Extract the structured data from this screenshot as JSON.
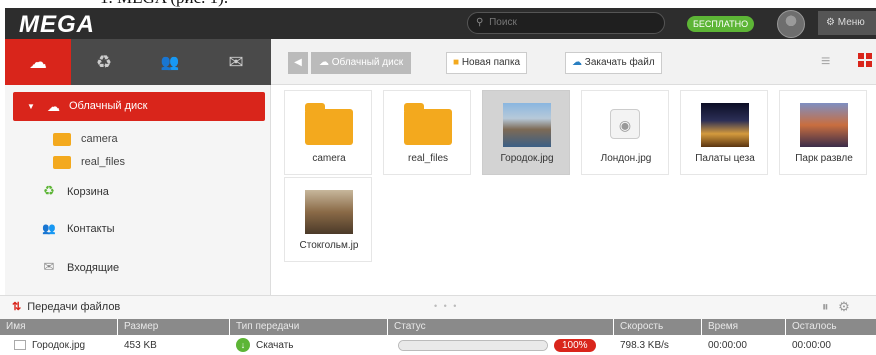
{
  "caption": "1. MEGA (рис. 1).",
  "header": {
    "logo": "MEGA",
    "search_placeholder": "Поиск",
    "plan_badge": "БЕСПЛАТНО",
    "menu_label": "Меню"
  },
  "tabs": [
    {
      "name": "cloud",
      "icon": "cloud-icon",
      "active": true
    },
    {
      "name": "rubbish",
      "icon": "recycle-icon",
      "active": false
    },
    {
      "name": "contacts",
      "icon": "contacts-icon",
      "active": false
    },
    {
      "name": "inbox",
      "icon": "envelope-icon",
      "active": false
    }
  ],
  "toolbar": {
    "breadcrumb": "Облачный диск",
    "new_folder": "Новая папка",
    "upload_file": "Закачать файл"
  },
  "sidebar": {
    "active_item": "Облачный диск",
    "folders": [
      "camera",
      "real_files"
    ],
    "items": [
      "Корзина",
      "Контакты",
      "Входящие"
    ]
  },
  "files": [
    {
      "name": "camera",
      "kind": "folder"
    },
    {
      "name": "real_files",
      "kind": "folder"
    },
    {
      "name": "Городок.jpg",
      "kind": "photo",
      "selected": true
    },
    {
      "name": "Лондон.jpg",
      "kind": "camera"
    },
    {
      "name": "Палаты цеза",
      "kind": "photo"
    },
    {
      "name": "Парк развле",
      "kind": "photo"
    },
    {
      "name": "Стокгольм.jp",
      "kind": "photo"
    }
  ],
  "transfers": {
    "title": "Передачи файлов",
    "columns": [
      "Имя",
      "Размер",
      "Тип передачи",
      "Статус",
      "Скорость",
      "Время",
      "Осталось"
    ],
    "rows": [
      {
        "name": "Городок.jpg",
        "size": "453 KB",
        "type": "Скачать",
        "progress_percent": 100,
        "status_label": "100%",
        "speed": "798.3 KB/s",
        "time": "00:00:00",
        "remaining": "00:00:00"
      }
    ]
  },
  "colors": {
    "accent": "#d9251b",
    "free_badge": "#5db536",
    "folder": "#f3a91e"
  }
}
